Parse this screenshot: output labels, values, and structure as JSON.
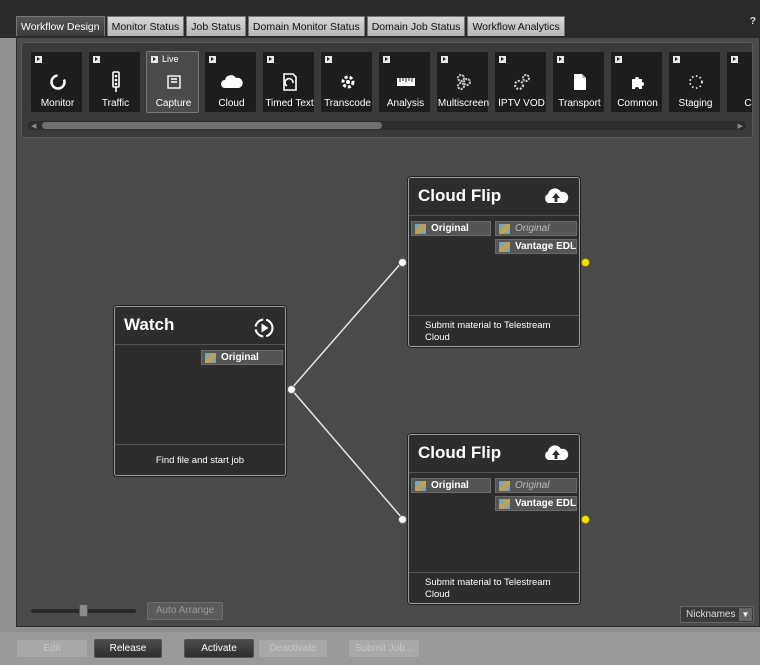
{
  "tabs": [
    {
      "label": "Workflow Design",
      "active": true
    },
    {
      "label": "Monitor Status"
    },
    {
      "label": "Job Status"
    },
    {
      "label": "Domain Monitor Status"
    },
    {
      "label": "Domain Job Status"
    },
    {
      "label": "Workflow Analytics"
    }
  ],
  "help_label": "?",
  "toolbox": {
    "tools": [
      {
        "label": "Monitor",
        "icon": "monitor-icon"
      },
      {
        "label": "Traffic",
        "icon": "traffic-icon"
      },
      {
        "label": "Capture",
        "icon": "capture-icon",
        "flag_text": "Live",
        "selected": true
      },
      {
        "label": "Cloud",
        "icon": "cloud-icon"
      },
      {
        "label": "Timed Text",
        "icon": "timed-text-icon"
      },
      {
        "label": "Transcode",
        "icon": "transcode-icon"
      },
      {
        "label": "Analysis",
        "icon": "analysis-icon"
      },
      {
        "label": "Multiscreen",
        "icon": "multiscreen-icon"
      },
      {
        "label": "IPTV VOD",
        "icon": "iptv-vod-icon"
      },
      {
        "label": "Transport",
        "icon": "transport-icon"
      },
      {
        "label": "Common",
        "icon": "common-icon"
      },
      {
        "label": "Staging",
        "icon": "staging-icon"
      },
      {
        "label": "Con",
        "icon": "con-icon"
      }
    ]
  },
  "nodes": {
    "watch": {
      "title": "Watch",
      "icon": "watch-play-icon",
      "output": "Original",
      "description": "Find file and start job"
    },
    "cloud_top": {
      "title": "Cloud Flip",
      "icon": "cloud-upload-icon",
      "input": "Original",
      "outputs": [
        "Original",
        "Vantage EDL"
      ],
      "description": "Submit material to Telestream Cloud"
    },
    "cloud_bottom": {
      "title": "Cloud Flip",
      "icon": "cloud-upload-icon",
      "input": "Original",
      "outputs": [
        "Original",
        "Vantage EDL"
      ],
      "description": "Submit material to Telestream Cloud"
    }
  },
  "canvas_controls": {
    "auto_arrange": "Auto Arrange",
    "nicknames": "Nicknames"
  },
  "bottom_buttons": {
    "edit": "Edit",
    "release": "Release",
    "activate": "Activate",
    "deactivate": "Deactivate",
    "submit_job": "Submit Job..."
  }
}
